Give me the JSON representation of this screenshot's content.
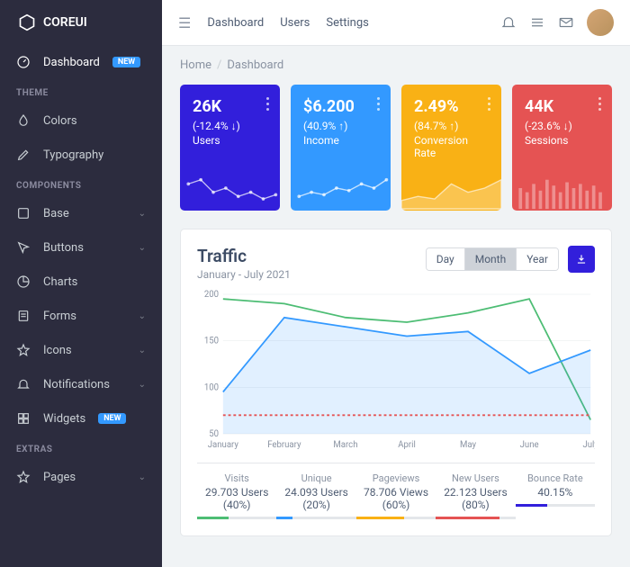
{
  "brand": "COREUI",
  "topnav": {
    "dashboard": "Dashboard",
    "users": "Users",
    "settings": "Settings"
  },
  "breadcrumb": {
    "home": "Home",
    "current": "Dashboard"
  },
  "sidebar": {
    "dashboard": {
      "label": "Dashboard",
      "badge": "NEW"
    },
    "sections": {
      "theme": "THEME",
      "components": "COMPONENTS",
      "extras": "EXTRAS"
    },
    "theme": [
      {
        "label": "Colors"
      },
      {
        "label": "Typography"
      }
    ],
    "components": [
      {
        "label": "Base"
      },
      {
        "label": "Buttons"
      },
      {
        "label": "Charts"
      },
      {
        "label": "Forms"
      },
      {
        "label": "Icons"
      },
      {
        "label": "Notifications"
      },
      {
        "label": "Widgets",
        "badge": "NEW"
      }
    ],
    "extras": [
      {
        "label": "Pages"
      }
    ]
  },
  "cards": [
    {
      "value": "26K",
      "delta": "(-12.4% ↓)",
      "label": "Users",
      "color": "#321fdb"
    },
    {
      "value": "$6.200",
      "delta": "(40.9% ↑)",
      "label": "Income",
      "color": "#3399ff"
    },
    {
      "value": "2.49%",
      "delta": "(84.7% ↑)",
      "label": "Conversion Rate",
      "color": "#f9b115"
    },
    {
      "value": "44K",
      "delta": "(-23.6% ↓)",
      "label": "Sessions",
      "color": "#e55353"
    }
  ],
  "traffic": {
    "title": "Traffic",
    "period": "January - July 2021",
    "range_buttons": {
      "day": "Day",
      "month": "Month",
      "year": "Year"
    },
    "stats": [
      {
        "label": "Visits",
        "value": "29.703 Users (40%)",
        "pct": 40,
        "color": "#4dbd74"
      },
      {
        "label": "Unique",
        "value": "24.093 Users (20%)",
        "pct": 20,
        "color": "#3399ff"
      },
      {
        "label": "Pageviews",
        "value": "78.706 Views (60%)",
        "pct": 60,
        "color": "#f9b115"
      },
      {
        "label": "New Users",
        "value": "22.123 Users (80%)",
        "pct": 80,
        "color": "#e55353"
      },
      {
        "label": "Bounce Rate",
        "value": "40.15%",
        "pct": 40,
        "color": "#321fdb"
      }
    ]
  },
  "chart_data": {
    "type": "line",
    "categories": [
      "January",
      "February",
      "March",
      "April",
      "May",
      "June",
      "July"
    ],
    "series": [
      {
        "name": "green",
        "values": [
          195,
          190,
          175,
          170,
          180,
          195,
          65
        ],
        "color": "#4dbd74"
      },
      {
        "name": "blue",
        "values": [
          95,
          175,
          165,
          155,
          160,
          115,
          140
        ],
        "color": "#3399ff",
        "fill": true
      },
      {
        "name": "red-dashed",
        "values": [
          70,
          70,
          70,
          70,
          70,
          70,
          70
        ],
        "color": "#e55353",
        "dashed": true
      }
    ],
    "ylim": [
      50,
      200
    ],
    "yticks": [
      50,
      100,
      150,
      200
    ],
    "xlabel": "",
    "ylabel": "",
    "title": "Traffic"
  }
}
